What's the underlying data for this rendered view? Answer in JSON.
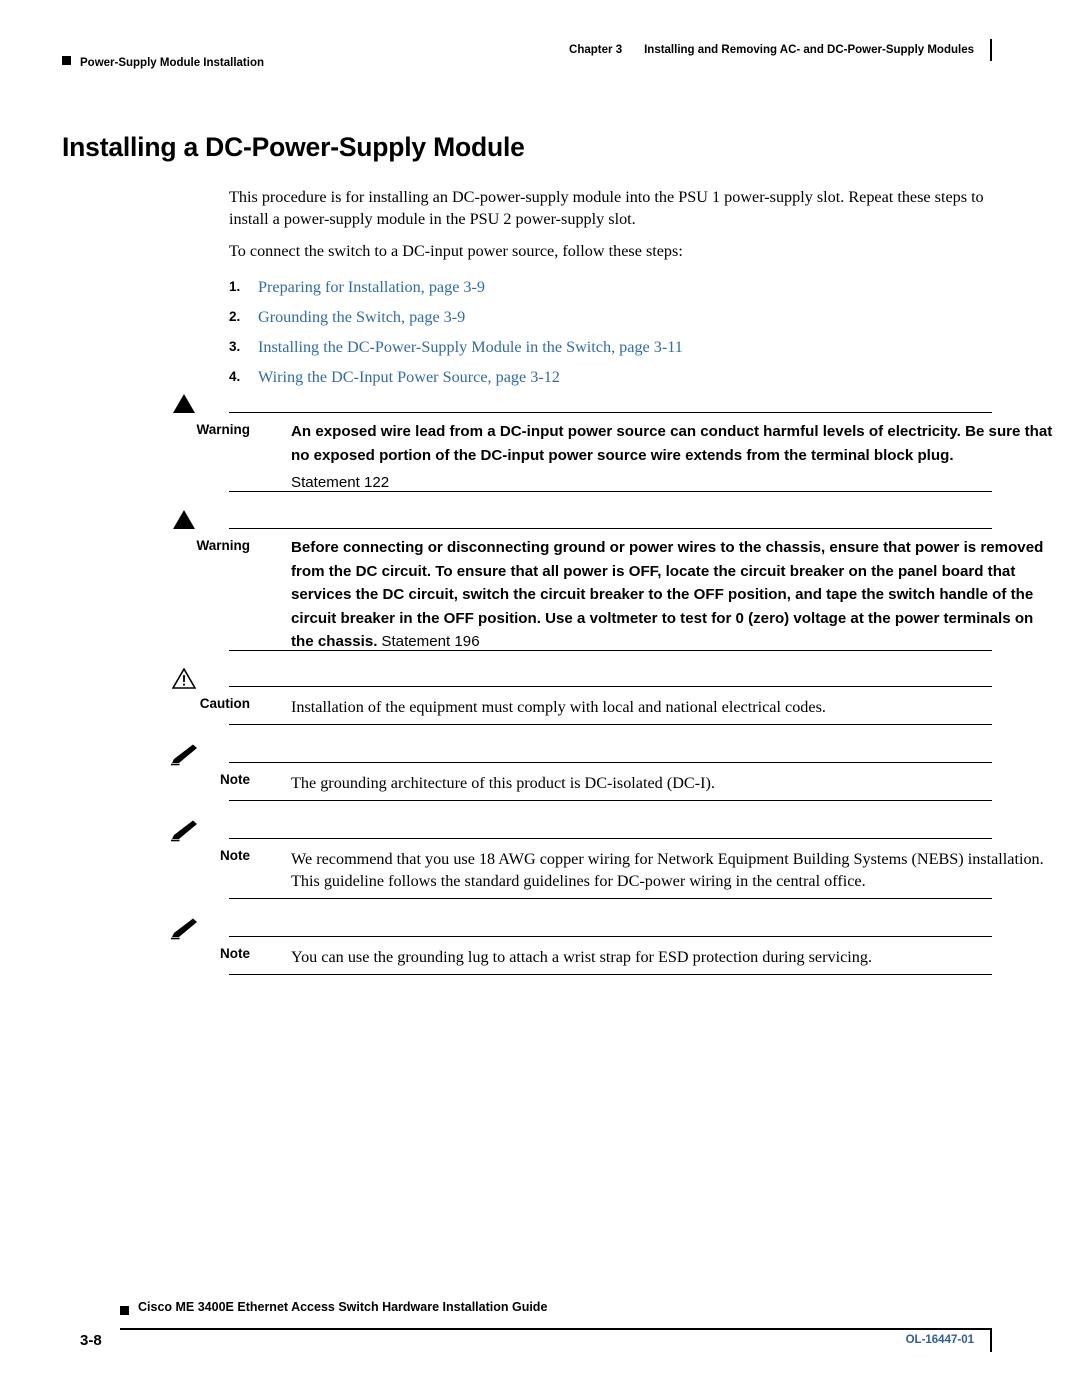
{
  "header": {
    "left_text": "Power-Supply Module Installation",
    "chapter": "Chapter 3",
    "chapter_title": "Installing and Removing AC- and DC-Power-Supply Modules"
  },
  "title": "Installing a DC-Power-Supply Module",
  "intro": {
    "para1": "This procedure is for installing an DC-power-supply module into the PSU 1 power-supply slot. Repeat these steps to install a power-supply module in the PSU 2 power-supply slot.",
    "para2": "To connect the switch to a DC-input power source, follow these steps:"
  },
  "steps": [
    {
      "num": "1.",
      "text": "Preparing for Installation, page 3-9"
    },
    {
      "num": "2.",
      "text": "Grounding the Switch, page 3-9"
    },
    {
      "num": "3.",
      "text": "Installing the DC-Power-Supply Module in the Switch, page 3-11"
    },
    {
      "num": "4.",
      "text": "Wiring the DC-Input Power Source, page 3-12"
    }
  ],
  "link_color": "#2f6cab",
  "admonitions": [
    {
      "type": "warning",
      "icon": "warning-triangle-icon",
      "label": "Warning",
      "bold_text": "An exposed wire lead from a DC-input power source can conduct harmful levels of electricity. Be sure that no exposed portion of the DC-input power source wire extends from the terminal block plug.",
      "statement": "Statement 122"
    },
    {
      "type": "warning",
      "icon": "warning-triangle-icon",
      "label": "Warning",
      "bold_text": "Before connecting or disconnecting ground or power wires to the chassis, ensure that power is removed from the DC circuit. To ensure that all power is OFF, locate the circuit breaker on the panel board that services the DC circuit, switch the circuit breaker to the OFF position, and tape the switch handle of the circuit breaker in the OFF position. Use a voltmeter to test for 0 (zero) voltage at the power terminals on the chassis.",
      "statement": "Statement 196"
    },
    {
      "type": "caution",
      "icon": "caution-triangle-icon",
      "label": "Caution",
      "plain_text": "Installation of the equipment must comply with local and national electrical codes."
    },
    {
      "type": "note",
      "icon": "note-pencil-icon",
      "label": "Note",
      "plain_text": "The grounding architecture of this product is DC-isolated (DC-I)."
    },
    {
      "type": "note",
      "icon": "note-pencil-icon",
      "label": "Note",
      "plain_text": "We recommend that you use 18 AWG copper wiring for Network Equipment Building Systems (NEBS) installation. This guideline follows the standard guidelines for DC-power wiring in the central office."
    },
    {
      "type": "note",
      "icon": "note-pencil-icon",
      "label": "Note",
      "plain_text": "You can use the grounding lug to attach a wrist strap for ESD protection during servicing."
    }
  ],
  "footer": {
    "page_number": "3-8",
    "guide_title": "Cisco ME 3400E Ethernet Access Switch Hardware Installation Guide",
    "doc_id": "OL-16447-01"
  }
}
